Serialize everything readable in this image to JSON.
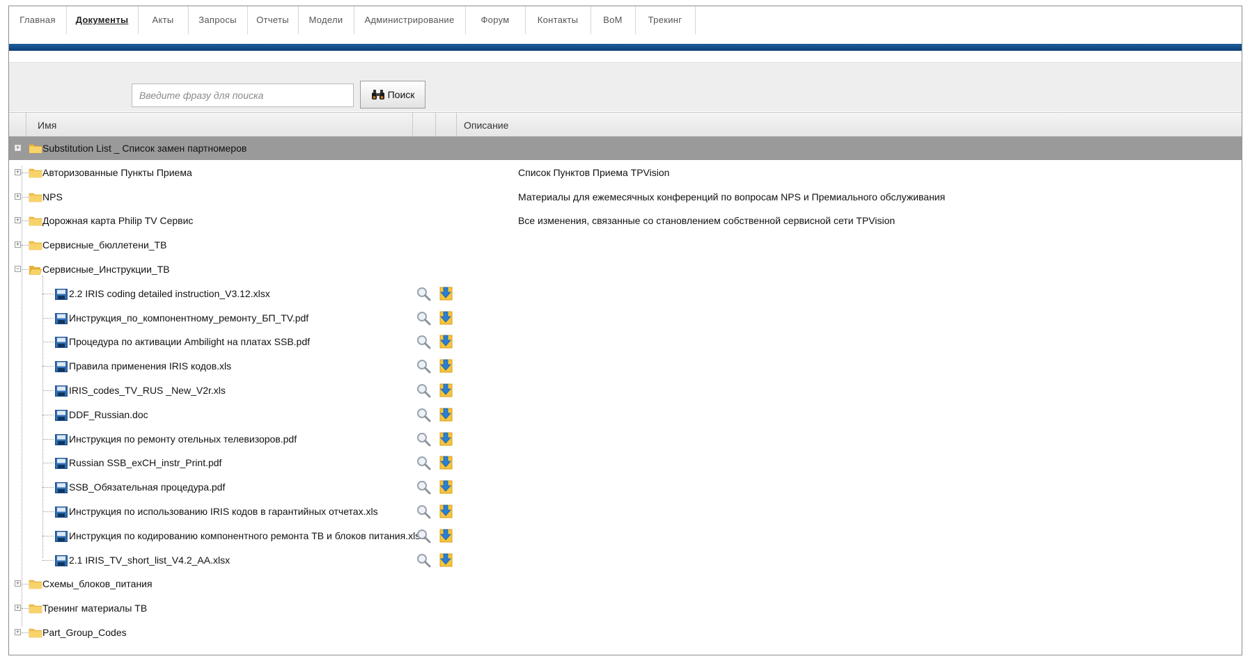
{
  "nav": {
    "items": [
      "Главная",
      "Документы",
      "Акты",
      "Запросы",
      "Отчеты",
      "Модели",
      "Администрирование",
      "Форум",
      "Контакты",
      "BoM",
      "Трекинг"
    ],
    "active": "Документы"
  },
  "search": {
    "placeholder": "Введите фразу для поиска",
    "button_label": "Поиск",
    "value": ""
  },
  "table": {
    "columns": {
      "name": "Имя",
      "description": "Описание"
    },
    "rows": [
      {
        "type": "folder",
        "name": "Substitution List _ Список замен партномеров",
        "description": "",
        "selected": true,
        "expanded": false
      },
      {
        "type": "folder",
        "name": "Авторизованные Пункты Приема",
        "description": "Список Пунктов Приема TPVision",
        "expanded": false
      },
      {
        "type": "folder",
        "name": "NPS",
        "description": "Материалы для ежемесячных конференций по вопросам NPS и Премиального обслуживания",
        "expanded": false
      },
      {
        "type": "folder",
        "name": "Дорожная карта Philip TV Сервис",
        "description": "Все изменения, связанные со становлением собственной сервисной сети TPVision",
        "expanded": false
      },
      {
        "type": "folder",
        "name": "Сервисные_бюллетени_ТВ",
        "description": "",
        "expanded": false
      },
      {
        "type": "folder",
        "name": "Сервисные_Инструкции_ТВ",
        "description": "",
        "expanded": true
      },
      {
        "type": "file",
        "name": "2.2 IRIS coding detailed instruction_V3.12.xlsx"
      },
      {
        "type": "file",
        "name": "Инструкция_по_компонентному_ремонту_БП_TV.pdf"
      },
      {
        "type": "file",
        "name": "Процедура по активации Ambilight на платах SSB.pdf"
      },
      {
        "type": "file",
        "name": "Правила применения IRIS кодов.xls"
      },
      {
        "type": "file",
        "name": "IRIS_codes_TV_RUS _New_V2r.xls"
      },
      {
        "type": "file",
        "name": "DDF_Russian.doc"
      },
      {
        "type": "file",
        "name": "Инструкция по ремонту отельных телевизоров.pdf"
      },
      {
        "type": "file",
        "name": "Russian SSB_exCH_instr_Print.pdf"
      },
      {
        "type": "file",
        "name": "SSB_Обязательная процедура.pdf"
      },
      {
        "type": "file",
        "name": "Инструкция по использованию IRIS кодов в гарантийных отчетах.xls"
      },
      {
        "type": "file",
        "name": "Инструкция по кодированию компонентного ремонта ТВ и блоков питания.xlsx"
      },
      {
        "type": "file",
        "name": "2.1 IRIS_TV_short_list_V4.2_AA.xlsx"
      },
      {
        "type": "folder",
        "name": "Схемы_блоков_питания",
        "description": "",
        "expanded": false
      },
      {
        "type": "folder",
        "name": "Тренинг материалы ТВ",
        "description": "",
        "expanded": false
      },
      {
        "type": "folder",
        "name": "Part_Group_Codes",
        "description": "",
        "expanded": false
      }
    ]
  },
  "icons": {
    "folder": "folder-icon",
    "file": "file-icon",
    "preview": "magnifier-icon",
    "download": "download-icon",
    "search": "binoculars-icon"
  },
  "colors": {
    "nav_bar": "#1d5d9a",
    "selected_row": "#9a9a9a",
    "folder": "#f5c24d"
  }
}
